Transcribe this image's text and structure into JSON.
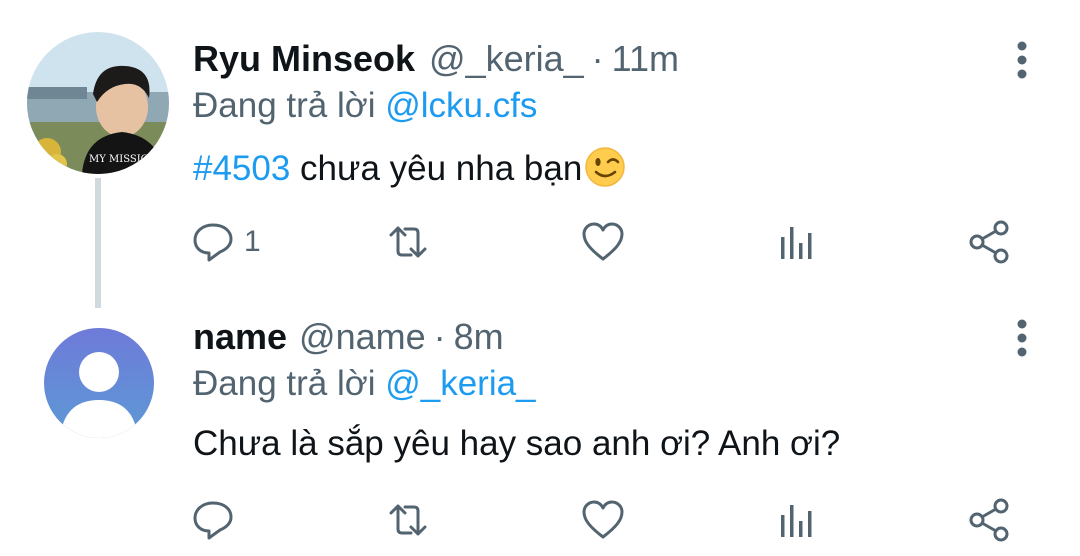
{
  "tweets": [
    {
      "display_name": "Ryu Minseok",
      "handle": "@_keria_",
      "separator": "·",
      "time": "11m",
      "reply_prefix": "Đang trả lời",
      "reply_mention": "@lcku.cfs",
      "hashtag": "#4503",
      "text": " chưa yêu nha bạn",
      "emoji": "winking-face",
      "reply_count": "1"
    },
    {
      "display_name": "name",
      "handle": "@name",
      "separator": "·",
      "time": "8m",
      "reply_prefix": "Đang trả lời",
      "reply_mention": "@_keria_",
      "text": "Chưa là sắp yêu hay sao anh ơi? Anh ơi?",
      "reply_count": ""
    }
  ],
  "colors": {
    "link": "#1d9bf0",
    "secondary": "#536471",
    "primary_text": "#0f1419",
    "thread_line": "#cfd9de"
  },
  "icons": [
    "more-vertical-icon",
    "reply-icon",
    "retweet-icon",
    "like-icon",
    "stats-icon",
    "share-icon"
  ]
}
